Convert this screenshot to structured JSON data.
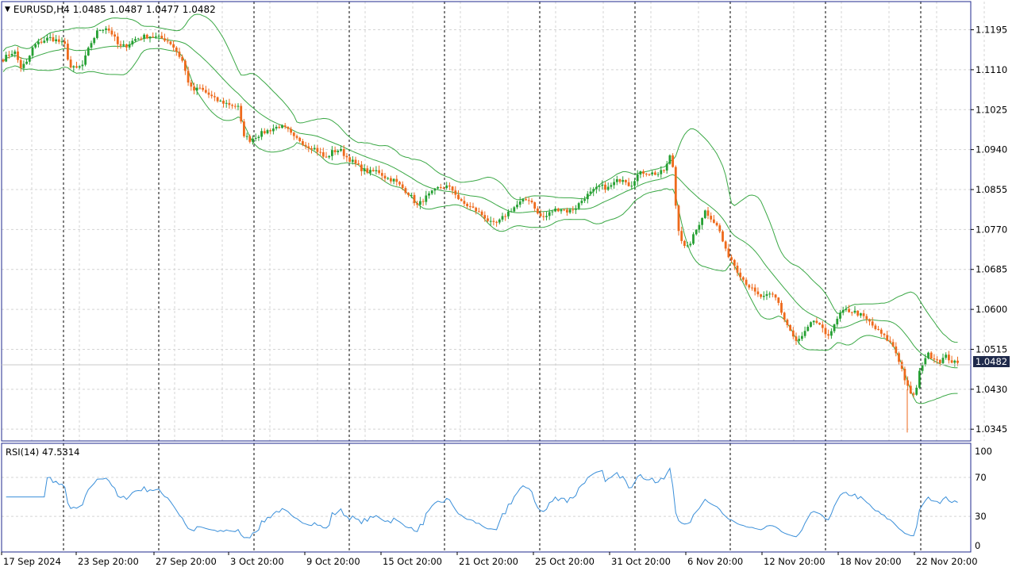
{
  "header": {
    "symbol_label": "EURUSD,H4",
    "open": "1.0485",
    "high": "1.0487",
    "low": "1.0477",
    "close": "1.0482"
  },
  "current_price": "1.0482",
  "rsi_label": "RSI(14) 47.5314",
  "colors": {
    "bull": "#26a033",
    "bear": "#ee6a1c",
    "bands": "#3aa845",
    "rsi": "#3a8fd9",
    "frame": "#1f2a8c",
    "grid": "#d4d4d4"
  },
  "chart_data": {
    "type": "candlestick",
    "price_ticks": [
      "1.1195",
      "1.1110",
      "1.1025",
      "1.0940",
      "1.0855",
      "1.0770",
      "1.0685",
      "1.0600",
      "1.0515",
      "1.0430",
      "1.0345"
    ],
    "rsi_ticks": [
      "100",
      "70",
      "30",
      "0"
    ],
    "time_labels": [
      "17 Sep 2024",
      "23 Sep 20:00",
      "27 Sep 20:00",
      "3 Oct 20:00",
      "9 Oct 20:00",
      "15 Oct 20:00",
      "21 Oct 20:00",
      "25 Oct 20:00",
      "31 Oct 20:00",
      "6 Nov 20:00",
      "12 Nov 20:00",
      "18 Nov 20:00",
      "22 Nov 20:00"
    ],
    "ylim": [
      1.032,
      1.1255
    ],
    "rsi_ylim": [
      0,
      100
    ],
    "path": [
      [
        0,
        1.1127
      ],
      [
        8,
        1.1138
      ],
      [
        18,
        1.115
      ],
      [
        26,
        1.1115
      ],
      [
        34,
        1.1125
      ],
      [
        42,
        1.116
      ],
      [
        52,
        1.117
      ],
      [
        62,
        1.1178
      ],
      [
        72,
        1.1172
      ],
      [
        82,
        1.1162
      ],
      [
        88,
        1.1115
      ],
      [
        96,
        1.1112
      ],
      [
        104,
        1.112
      ],
      [
        114,
        1.1165
      ],
      [
        124,
        1.1195
      ],
      [
        134,
        1.12
      ],
      [
        142,
        1.1185
      ],
      [
        150,
        1.1158
      ],
      [
        160,
        1.1162
      ],
      [
        170,
        1.1175
      ],
      [
        180,
        1.118
      ],
      [
        190,
        1.1182
      ],
      [
        200,
        1.1178
      ],
      [
        208,
        1.1175
      ],
      [
        216,
        1.1165
      ],
      [
        222,
        1.115
      ],
      [
        230,
        1.1128
      ],
      [
        236,
        1.109
      ],
      [
        242,
        1.1065
      ],
      [
        252,
        1.107
      ],
      [
        262,
        1.1058
      ],
      [
        272,
        1.1045
      ],
      [
        282,
        1.104
      ],
      [
        292,
        1.1035
      ],
      [
        300,
        1.103
      ],
      [
        306,
        1.0975
      ],
      [
        314,
        1.096
      ],
      [
        324,
        1.097
      ],
      [
        334,
        1.0978
      ],
      [
        344,
        1.0985
      ],
      [
        352,
        1.099
      ],
      [
        362,
        1.0982
      ],
      [
        370,
        1.0965
      ],
      [
        378,
        1.096
      ],
      [
        386,
        1.0948
      ],
      [
        394,
        1.0945
      ],
      [
        402,
        1.0935
      ],
      [
        410,
        1.092
      ],
      [
        418,
        1.0935
      ],
      [
        428,
        1.094
      ],
      [
        436,
        1.0925
      ],
      [
        446,
        1.0912
      ],
      [
        456,
        1.0898
      ],
      [
        466,
        1.0892
      ],
      [
        476,
        1.0895
      ],
      [
        486,
        1.088
      ],
      [
        496,
        1.0875
      ],
      [
        506,
        1.086
      ],
      [
        516,
        1.0845
      ],
      [
        526,
        1.082
      ],
      [
        534,
        1.0835
      ],
      [
        542,
        1.0845
      ],
      [
        552,
        1.0858
      ],
      [
        562,
        1.0862
      ],
      [
        572,
        1.0852
      ],
      [
        580,
        1.0828
      ],
      [
        590,
        1.082
      ],
      [
        600,
        1.081
      ],
      [
        610,
        1.0798
      ],
      [
        620,
        1.078
      ],
      [
        628,
        1.0785
      ],
      [
        636,
        1.08
      ],
      [
        646,
        1.0815
      ],
      [
        656,
        1.0828
      ],
      [
        666,
        1.0835
      ],
      [
        672,
        1.0825
      ],
      [
        678,
        1.08
      ],
      [
        686,
        1.0795
      ],
      [
        696,
        1.081
      ],
      [
        706,
        1.0815
      ],
      [
        716,
        1.0808
      ],
      [
        726,
        1.0818
      ],
      [
        736,
        1.0838
      ],
      [
        746,
        1.085
      ],
      [
        756,
        1.0862
      ],
      [
        766,
        1.0858
      ],
      [
        776,
        1.0872
      ],
      [
        786,
        1.088
      ],
      [
        794,
        1.0862
      ],
      [
        802,
        1.0885
      ],
      [
        810,
        1.0892
      ],
      [
        820,
        1.089
      ],
      [
        830,
        1.0888
      ],
      [
        838,
        1.0898
      ],
      [
        845,
        1.093
      ],
      [
        848,
        1.09
      ],
      [
        852,
        1.0805
      ],
      [
        856,
        1.076
      ],
      [
        864,
        1.0725
      ],
      [
        872,
        1.075
      ],
      [
        880,
        1.078
      ],
      [
        888,
        1.081
      ],
      [
        896,
        1.0795
      ],
      [
        906,
        1.077
      ],
      [
        914,
        1.0725
      ],
      [
        922,
        1.0705
      ],
      [
        930,
        1.068
      ],
      [
        938,
        1.066
      ],
      [
        946,
        1.0645
      ],
      [
        954,
        1.063
      ],
      [
        962,
        1.0625
      ],
      [
        972,
        1.0632
      ],
      [
        980,
        1.062
      ],
      [
        986,
        1.0585
      ],
      [
        994,
        1.056
      ],
      [
        1002,
        1.053
      ],
      [
        1010,
        1.054
      ],
      [
        1018,
        1.056
      ],
      [
        1026,
        1.0578
      ],
      [
        1034,
        1.056
      ],
      [
        1042,
        1.0545
      ],
      [
        1050,
        1.056
      ],
      [
        1058,
        1.059
      ],
      [
        1066,
        1.0598
      ],
      [
        1076,
        1.0595
      ],
      [
        1084,
        1.0588
      ],
      [
        1094,
        1.0575
      ],
      [
        1102,
        1.056
      ],
      [
        1110,
        1.0548
      ],
      [
        1118,
        1.0535
      ],
      [
        1126,
        1.052
      ],
      [
        1134,
        1.0485
      ],
      [
        1142,
        1.044
      ],
      [
        1148,
        1.0415
      ],
      [
        1154,
        1.0425
      ],
      [
        1160,
        1.048
      ],
      [
        1168,
        1.0505
      ],
      [
        1176,
        1.0498
      ],
      [
        1184,
        1.049
      ],
      [
        1192,
        1.05
      ],
      [
        1200,
        1.0488
      ],
      [
        1210,
        1.0482
      ]
    ]
  }
}
